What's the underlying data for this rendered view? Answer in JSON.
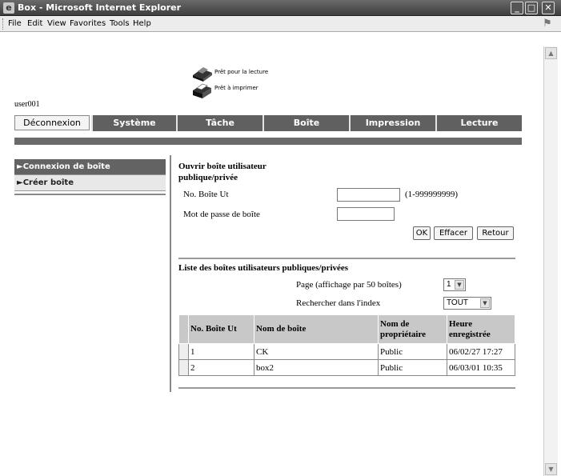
{
  "window": {
    "title": "Box - Microsoft Internet Explorer",
    "menu": [
      "File",
      "Edit",
      "View",
      "Favorites",
      "Tools",
      "Help"
    ]
  },
  "status": {
    "read_ready": "Prêt pour la lecture",
    "print_ready": "Prêt à imprimer"
  },
  "user": "user001",
  "nav": {
    "logout": "Déconnexion",
    "tabs": [
      "Système",
      "Tâche",
      "Boîte",
      "Impression",
      "Lecture"
    ]
  },
  "sidebar": {
    "items": [
      {
        "label": "Connexion de boîte",
        "active": true
      },
      {
        "label": "Créer boîte",
        "active": false
      }
    ]
  },
  "open_box": {
    "title": "Ouvrir boîte utilisateur publique/privée",
    "box_no_label": "No. Boîte Ut",
    "box_no_value": "",
    "box_no_range": "(1-999999999)",
    "password_label": "Mot de passe de boîte",
    "password_value": "",
    "ok": "OK",
    "clear": "Effacer",
    "back": "Retour"
  },
  "list": {
    "title": "Liste des boîtes utilisateurs publiques/privées",
    "page_label": "Page (affichage par 50 boîtes)",
    "page_value": "1",
    "index_label": "Rechercher dans l'index",
    "index_value": "TOUT",
    "columns": [
      "No. Boîte Ut",
      "Nom de boîte",
      "Nom de propriétaire",
      "Heure enregistrée"
    ],
    "rows": [
      {
        "no": "1",
        "name": "CK",
        "owner": "Public",
        "time": "06/02/27 17:27"
      },
      {
        "no": "2",
        "name": "box2",
        "owner": "Public",
        "time": "06/03/01 10:35"
      }
    ]
  },
  "colors": {
    "tab_bg": "#606060",
    "active_nav_bg": "#636363",
    "header_bg": "#c8c8c8"
  }
}
